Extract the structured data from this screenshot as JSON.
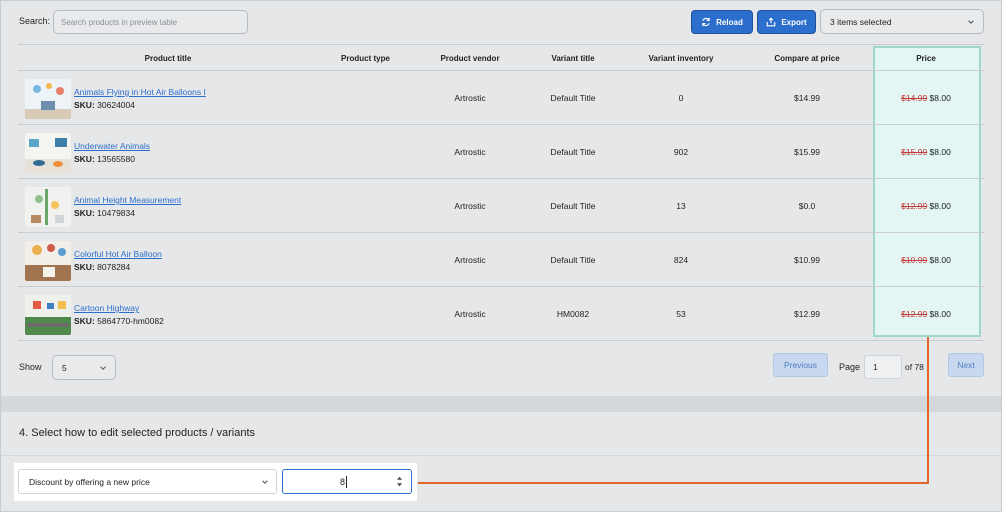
{
  "search": {
    "label": "Search:",
    "placeholder": "Search products in preview table"
  },
  "toolbar": {
    "reload_label": "Reload",
    "export_label": "Export",
    "selected_label": "3 items selected"
  },
  "table": {
    "headers": [
      "Product title",
      "Product type",
      "Product vendor",
      "Variant title",
      "Variant inventory",
      "Compare at price",
      "Price"
    ],
    "rows": [
      {
        "title": "Animals Flying in Hot Air Balloons I",
        "sku_label": "SKU:",
        "sku": "30624004",
        "type": "",
        "vendor": "Artrostic",
        "variant": "Default Title",
        "inventory": "0",
        "compare": "$14.99",
        "old_price": "$14.99",
        "new_price": "$8.00"
      },
      {
        "title": "Underwater Animals",
        "sku_label": "SKU:",
        "sku": "13565580",
        "type": "",
        "vendor": "Artrostic",
        "variant": "Default Title",
        "inventory": "902",
        "compare": "$15.99",
        "old_price": "$15.99",
        "new_price": "$8.00"
      },
      {
        "title": "Animal Height Measurement",
        "sku_label": "SKU:",
        "sku": "10479834",
        "type": "",
        "vendor": "Artrostic",
        "variant": "Default Title",
        "inventory": "13",
        "compare": "$0.0",
        "old_price": "$12.99",
        "new_price": "$8.00"
      },
      {
        "title": "Colorful Hot Air Balloon",
        "sku_label": "SKU:",
        "sku": "8078284",
        "type": "",
        "vendor": "Artrostic",
        "variant": "Default Title",
        "inventory": "824",
        "compare": "$10.99",
        "old_price": "$10.99",
        "new_price": "$8.00"
      },
      {
        "title": "Cartoon Highway",
        "sku_label": "SKU:",
        "sku": "5864770-hm0082",
        "type": "",
        "vendor": "Artrostic",
        "variant": "HM0082",
        "inventory": "53",
        "compare": "$12.99",
        "old_price": "$12.99",
        "new_price": "$8.00"
      }
    ]
  },
  "pagination": {
    "show_label": "Show",
    "show_value": "5",
    "previous_label": "Previous",
    "page_label": "Page",
    "page_value": "1",
    "of_label": "of 78",
    "next_label": "Next"
  },
  "edit": {
    "section_title": "4. Select how to edit selected products / variants",
    "method_value": "Discount by offering a new price",
    "amount_value": "8"
  },
  "colors": {
    "primary": "#2c6ecb",
    "highlight_border": "#9fd7cc",
    "highlight_fill": "#e2f8f5",
    "connector": "#e0662a",
    "strike": "#c23a3a"
  }
}
